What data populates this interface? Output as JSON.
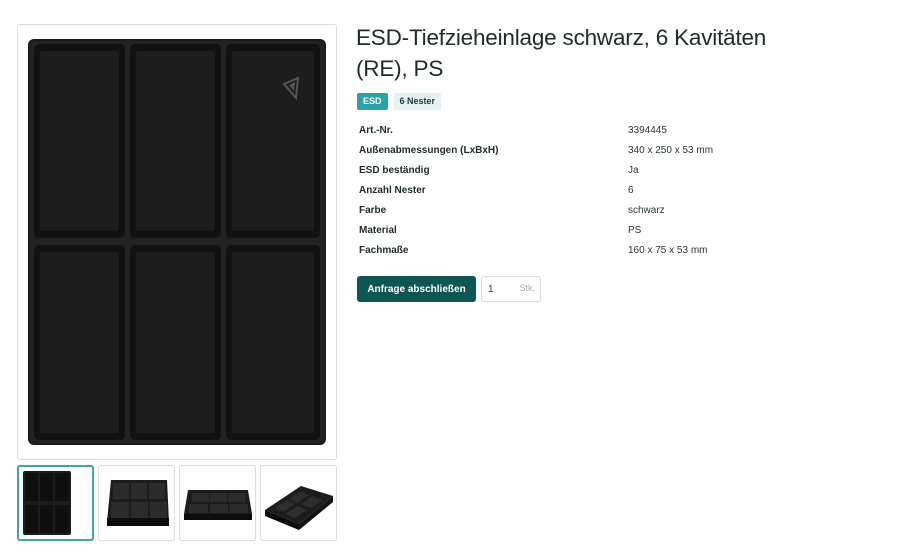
{
  "product": {
    "title": "ESD-Tiefzieheinlage schwarz, 6 Kavitäten (RE), PS",
    "badges": [
      "ESD",
      "6 Nester"
    ],
    "specs": [
      {
        "label": "Art.-Nr.",
        "value": "3394445"
      },
      {
        "label": "Außenabmessungen (LxBxH)",
        "value": "340 x 250 x 53 mm"
      },
      {
        "label": "ESD beständig",
        "value": "Ja"
      },
      {
        "label": "Anzahl Nester",
        "value": "6"
      },
      {
        "label": "Farbe",
        "value": "schwarz"
      },
      {
        "label": "Material",
        "value": "PS"
      },
      {
        "label": "Fachmaße",
        "value": "160 x 75 x 53 mm"
      }
    ]
  },
  "actions": {
    "request_label": "Anfrage abschließen",
    "quantity_value": "1",
    "quantity_unit": "Stk."
  },
  "gallery": {
    "thumbnail_count": 4,
    "active_thumbnail": 1,
    "main_image_icon": "esd-symbol-icon"
  },
  "colors": {
    "accent": "#2aa4a6",
    "button": "#0e5653",
    "tray": "#1b1b1b"
  }
}
